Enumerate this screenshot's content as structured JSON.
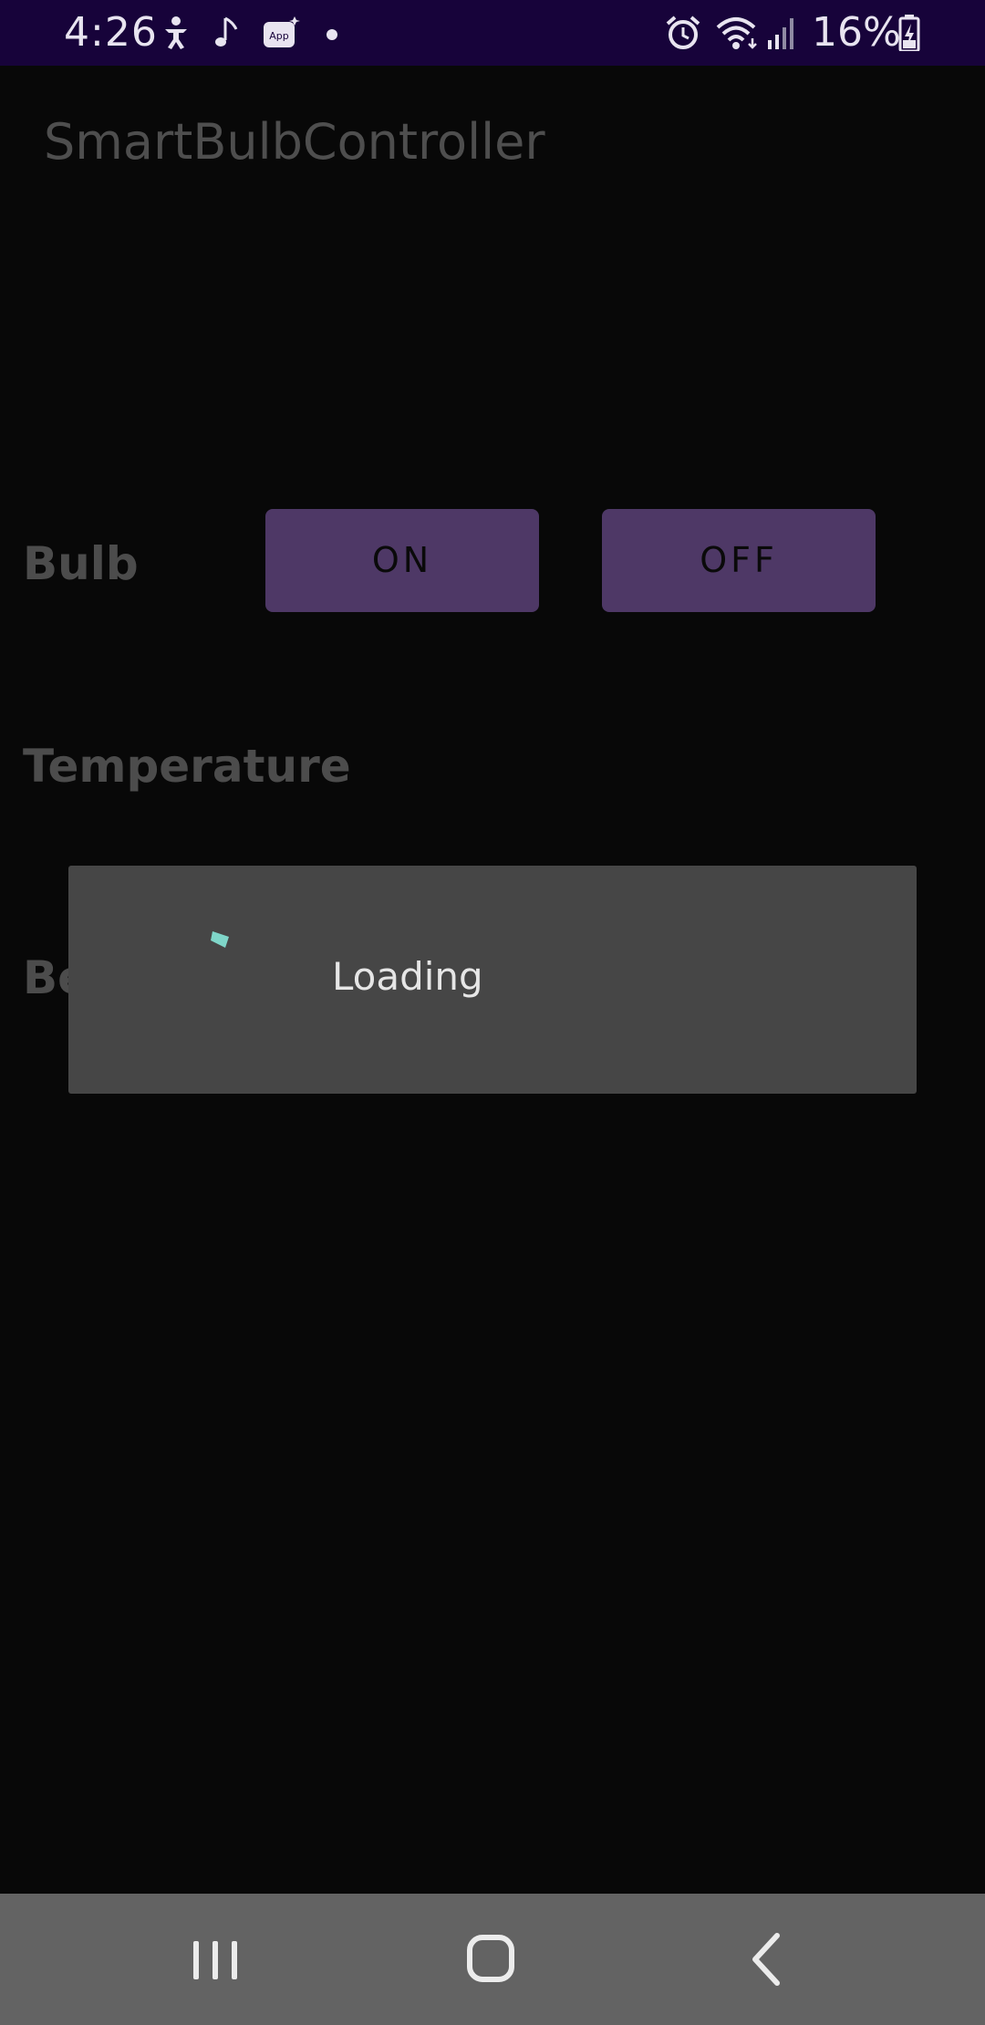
{
  "status_bar": {
    "time": "4:26",
    "left_icons": [
      "accessibility-icon",
      "music-note-icon",
      "app-notification-icon",
      "dot-icon"
    ],
    "right_icons": [
      "alarm-icon",
      "wifi-icon",
      "signal-icon",
      "battery-charging-icon"
    ],
    "battery": "16%"
  },
  "app_bar": {
    "title": "SmartBulbController"
  },
  "bulb_row": {
    "label": "Bulb",
    "on_label": "ON",
    "off_label": "OFF"
  },
  "temperature_row": {
    "label": "Temperature"
  },
  "brightness_row": {
    "label": "Be"
  },
  "loading_dialog": {
    "message": "Loading",
    "spinner_color": "#7fd6c9"
  },
  "nav_bar": {
    "buttons": [
      "recents-icon",
      "home-icon",
      "back-icon"
    ]
  },
  "colors": {
    "status_bar": "#17033a",
    "background": "#080808",
    "button": "#4e3866",
    "dialog": "#464646",
    "nav_bar": "#636363"
  }
}
